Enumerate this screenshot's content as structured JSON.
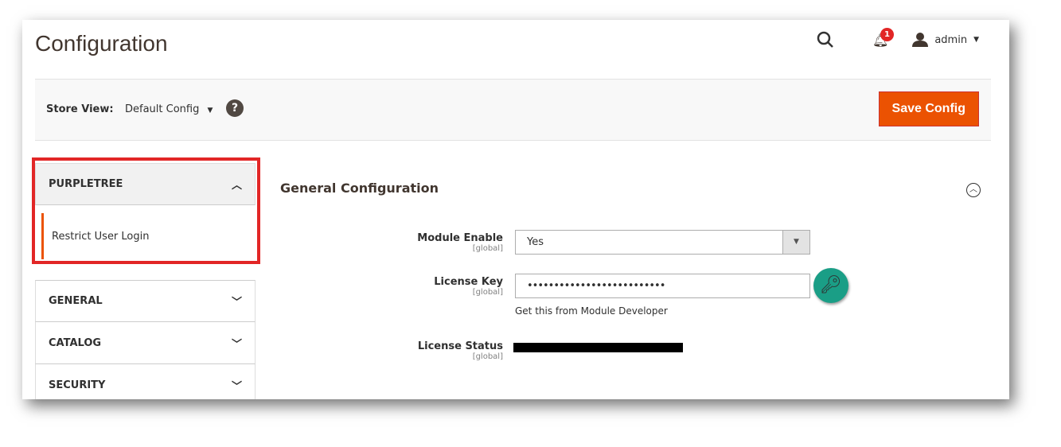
{
  "header": {
    "title": "Configuration",
    "notifications": "1",
    "user": "admin"
  },
  "store_view": {
    "label": "Store View:",
    "value": "Default Config",
    "help": "?"
  },
  "save_label": "Save Config",
  "sidebar": {
    "sections": [
      {
        "label": "PURPLETREE",
        "expanded": true,
        "items": [
          "Restrict User Login"
        ]
      },
      {
        "label": "GENERAL"
      },
      {
        "label": "CATALOG"
      },
      {
        "label": "SECURITY"
      }
    ]
  },
  "main": {
    "section_title": "General Configuration",
    "fields": [
      {
        "label": "Module Enable",
        "scope": "[global]",
        "value": "Yes"
      },
      {
        "label": "License Key",
        "scope": "[global]",
        "value": "••••••••••••••••••••••••••",
        "note": "Get this from Module Developer"
      },
      {
        "label": "License Status",
        "scope": "[global]"
      }
    ]
  },
  "colors": {
    "accent": "#eb5202",
    "highlight": "#e22626",
    "key_button": "#1a9e86"
  }
}
